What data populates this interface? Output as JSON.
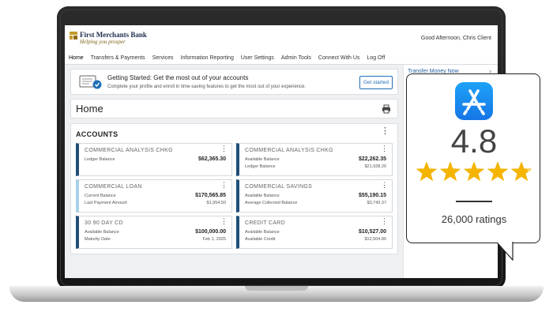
{
  "bank": {
    "name": "First Merchants Bank",
    "tagline": "Helping you prosper",
    "greeting": "Good Afternoon, Chris Client"
  },
  "nav": {
    "items": [
      "Home",
      "Transfers & Payments",
      "Services",
      "Information Reporting",
      "User Settings",
      "Admin Tools",
      "Connect With Us",
      "Log Off"
    ]
  },
  "getting_started": {
    "title": "Getting Started: Get the most out of your accounts",
    "text": "Complete your profile and enroll in time-saving features to get the most out of your experience.",
    "button": "Get started"
  },
  "sidepanel": {
    "link": "Transfer Money Now",
    "chevron": "›"
  },
  "home": {
    "title": "Home",
    "print_icon": "printer-icon"
  },
  "accounts": {
    "title": "ACCOUNTS",
    "more": "⋮",
    "cards": [
      {
        "name": "COMMERCIAL ANALYSIS CHKG",
        "l1": "Ledger Balance",
        "l2": "",
        "v1": "$62,365.30",
        "v2": "",
        "accent": "#1f4e79"
      },
      {
        "name": "COMMERCIAL ANALYSIS CHKG",
        "l1": "Available Balance",
        "l2": "Ledger Balance",
        "v1": "$22,262.35",
        "v2": "$21,928.20",
        "accent": "#1f4e79"
      },
      {
        "name": "COMMERCIAL LOAN",
        "l1": "Current Balance",
        "l2": "Last Payment Amount",
        "v1": "$170,565.85",
        "v2": "$1,954.50",
        "accent": "#a8d0ea"
      },
      {
        "name": "COMMERCIAL SAVINGS",
        "l1": "Available Balance",
        "l2": "Average Collected Balance",
        "v1": "$55,190.15",
        "v2": "$3,743.37",
        "accent": "#1f4e79"
      },
      {
        "name": "30 90 DAY CD",
        "l1": "Available Balance",
        "l2": "Maturity Date",
        "v1": "$100,000.00",
        "v2": "Feb 1, 2025",
        "accent": "#1f4e79"
      },
      {
        "name": "CREDIT CARD",
        "l1": "Available Balance",
        "l2": "Available Credit",
        "v1": "$10,527.00",
        "v2": "$12,504.80",
        "accent": "#1f4e79"
      }
    ]
  },
  "rating": {
    "value": "4.8",
    "stars": 4.8,
    "count": "26,000 ratings",
    "star_color": "#f4b400",
    "icon": "app-store-icon"
  }
}
